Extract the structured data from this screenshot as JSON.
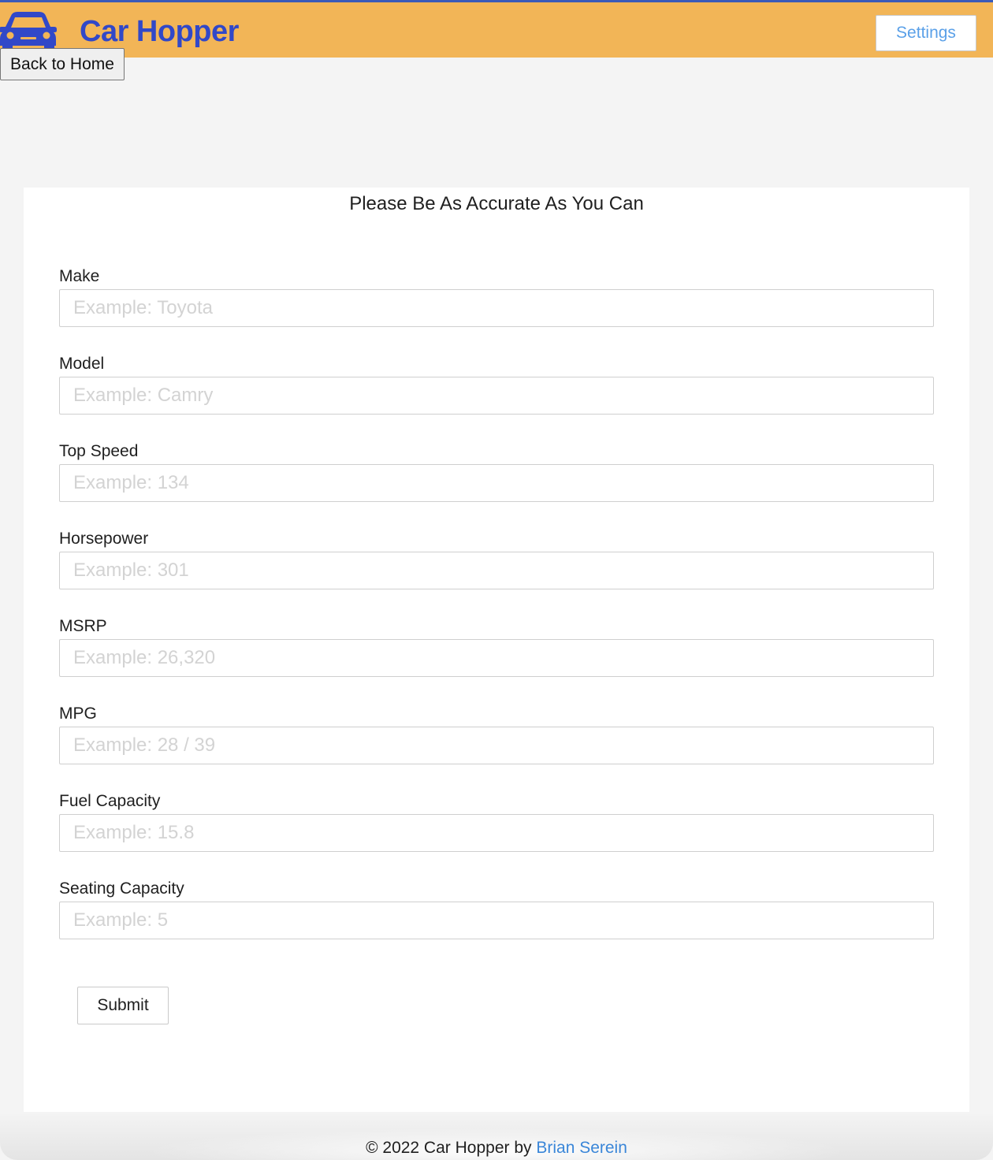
{
  "header": {
    "brand_icon": "car-icon",
    "brand_title": "Car Hopper",
    "settings_label": "Settings",
    "colors": {
      "bar": "#f2b557",
      "brand": "#3148c8",
      "settings_text": "#5aa0e8"
    }
  },
  "nav": {
    "back_label": "Back to Home"
  },
  "form": {
    "title": "Please Be As Accurate As You Can",
    "fields": [
      {
        "label": "Make",
        "placeholder": "Example: Toyota"
      },
      {
        "label": "Model",
        "placeholder": "Example: Camry"
      },
      {
        "label": "Top Speed",
        "placeholder": "Example: 134"
      },
      {
        "label": "Horsepower",
        "placeholder": "Example: 301"
      },
      {
        "label": "MSRP",
        "placeholder": "Example: 26,320"
      },
      {
        "label": "MPG",
        "placeholder": "Example: 28 / 39"
      },
      {
        "label": "Fuel Capacity",
        "placeholder": "Example: 15.8"
      },
      {
        "label": "Seating Capacity",
        "placeholder": "Example: 5"
      }
    ],
    "submit_label": "Submit"
  },
  "footer": {
    "text": "© 2022 Car Hopper by",
    "author_link": "Brian Serein",
    "link_color": "#3a86d8"
  }
}
